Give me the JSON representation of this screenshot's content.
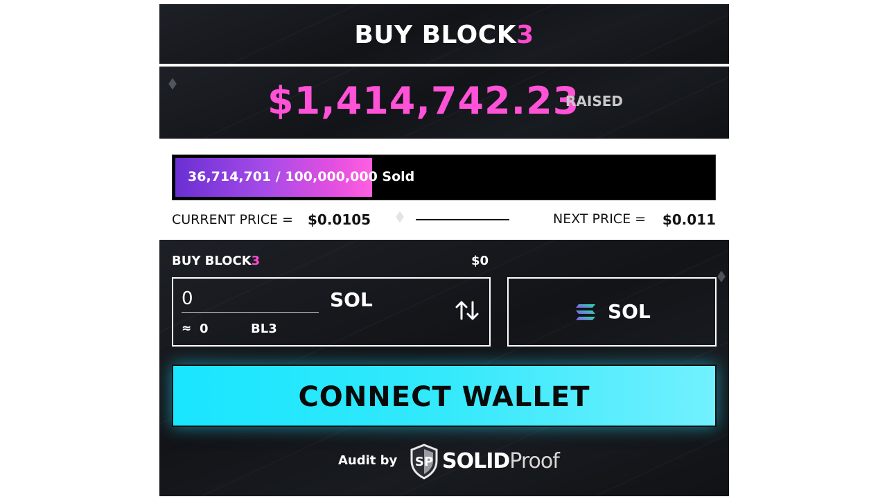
{
  "header": {
    "title_main": "BUY BLOCK",
    "title_accent": "3"
  },
  "raised": {
    "amount": "$1,414,742.23",
    "label": "RAISED"
  },
  "progress": {
    "text": "36,714,701 / 100,000,000 Sold",
    "sold": 36714701,
    "total": 100000000,
    "fraction": 0.367
  },
  "pricing": {
    "current_label": "CURRENT PRICE =",
    "current_value": "$0.0105",
    "next_label": "NEXT PRICE =",
    "next_value": "$0.011"
  },
  "buy": {
    "label_main": "BUY BLOCK",
    "label_accent": "3",
    "usd_value": "$0",
    "amount_value": "0",
    "amount_currency": "SOL",
    "approx_sign": "≈",
    "approx_value": "0",
    "token_symbol": "BL3",
    "selected_currency": "SOL"
  },
  "connect_wallet": {
    "label": "CONNECT WALLET"
  },
  "audit": {
    "label": "Audit by",
    "brand_bold": "SOLID",
    "brand_light": "Proof"
  },
  "colors": {
    "accent_pink": "#ff4ad0",
    "cyan": "#19e6ff",
    "progress_start": "#6a2fd2",
    "progress_end": "#ff5fe1",
    "panel_dark": "#15171b"
  },
  "icons": {
    "swap": "swap-vertical-arrows-icon",
    "currency": "solana-logo-icon",
    "auditor": "solidproof-shield-logo"
  }
}
